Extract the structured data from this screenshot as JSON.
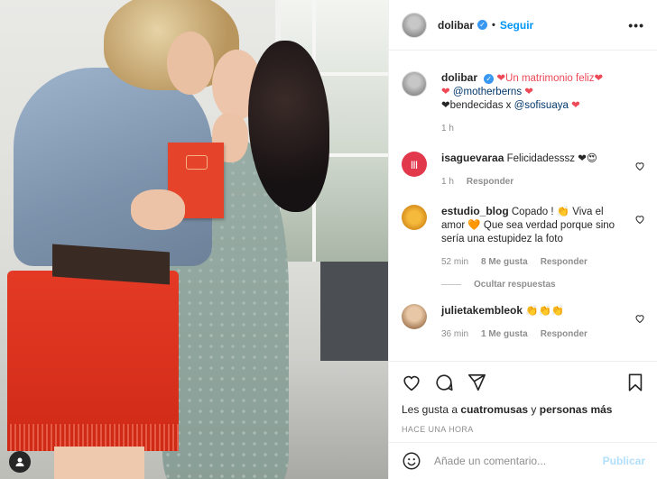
{
  "post": {
    "username": "dolibar",
    "follow_label": "Seguir",
    "more_label": "•••",
    "photo_alt": "",
    "caption_line1": "❤Un matrimonio feliz❤",
    "caption_heart": "❤",
    "caption_mention1": "@motherberns",
    "caption_line3_pre": "❤bendecidas x ",
    "caption_mention2": "@sofisuaya",
    "caption_line3_post": " ❤",
    "caption_time": "1 h"
  },
  "comments": [
    {
      "username": "isaguevaraa",
      "text": "Felicidadesssz",
      "emoji": "❤😍",
      "time": "1 h",
      "reply_label": "Responder"
    },
    {
      "username": "estudio_blog",
      "text": "Copado ! 👏 Viva el amor 🧡 Que sea verdad porque sino sería una estupidez la foto",
      "time": "52 min",
      "likes": "8 Me gusta",
      "reply_label": "Responder",
      "hide_replies": "Ocultar respuestas"
    },
    {
      "username": "julietakembleok",
      "text": "👏👏👏",
      "time": "36 min",
      "likes": "1 Me gusta",
      "reply_label": "Responder"
    }
  ],
  "actions": {
    "likes_prefix": "Les gusta a ",
    "likes_user": "cuatromusas",
    "likes_mid": " y ",
    "likes_more": "personas más",
    "timestamp": "HACE UNA HORA"
  },
  "add_comment": {
    "placeholder": "Añade un comentario...",
    "publish_label": "Publicar"
  },
  "colors": {
    "link": "#0095f6",
    "mention": "#00376b",
    "muted": "#8e8e8e",
    "publish_disabled": "#b2dffc"
  }
}
